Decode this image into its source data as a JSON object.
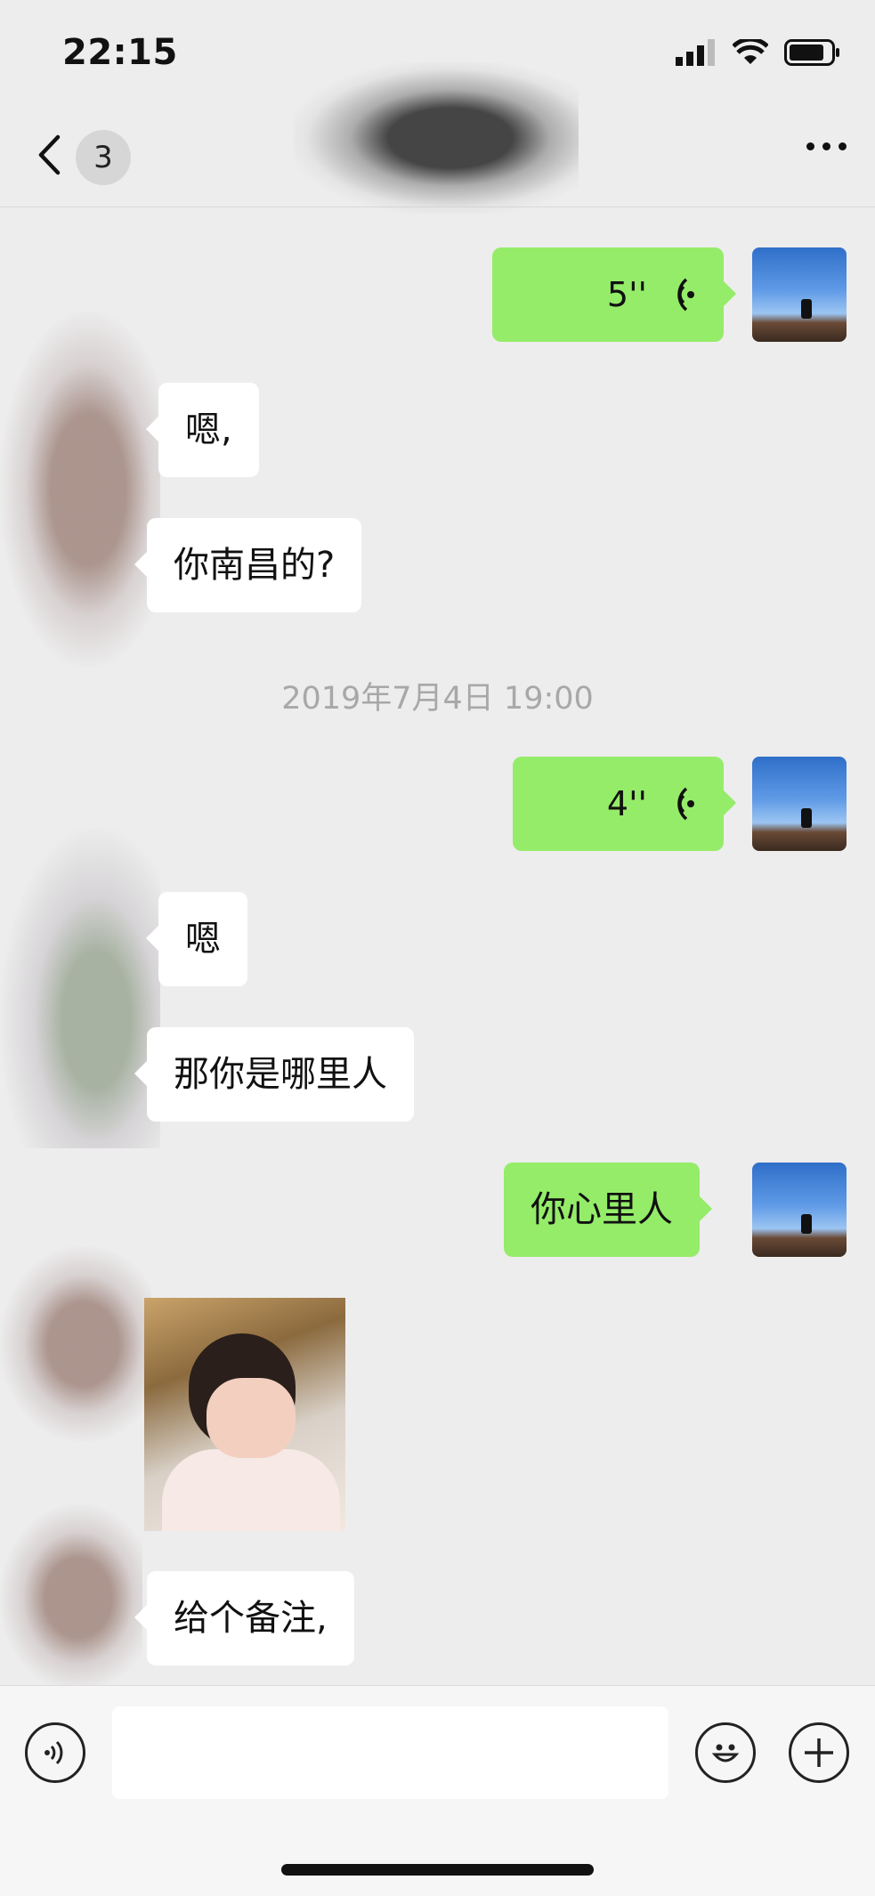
{
  "status_bar": {
    "time": "22:15"
  },
  "nav": {
    "unread_count": "3"
  },
  "messages": {
    "m1_voice_duration": "5''",
    "m2_text": "嗯,",
    "m3_text": "你南昌的?",
    "timestamp": "2019年7月4日 19:00",
    "m4_voice_duration": "4''",
    "m5_text": "嗯",
    "m6_text": "那你是哪里人",
    "m7_text": "你心里人",
    "m9_text": "给个备注,"
  },
  "colors": {
    "outgoing_bubble": "#95ec69",
    "incoming_bubble": "#ffffff",
    "background": "#ededed"
  },
  "icons": [
    "back-chevron-icon",
    "more-icon",
    "voice-wave-icon",
    "voice-input-icon",
    "emoji-icon",
    "plus-icon"
  ]
}
